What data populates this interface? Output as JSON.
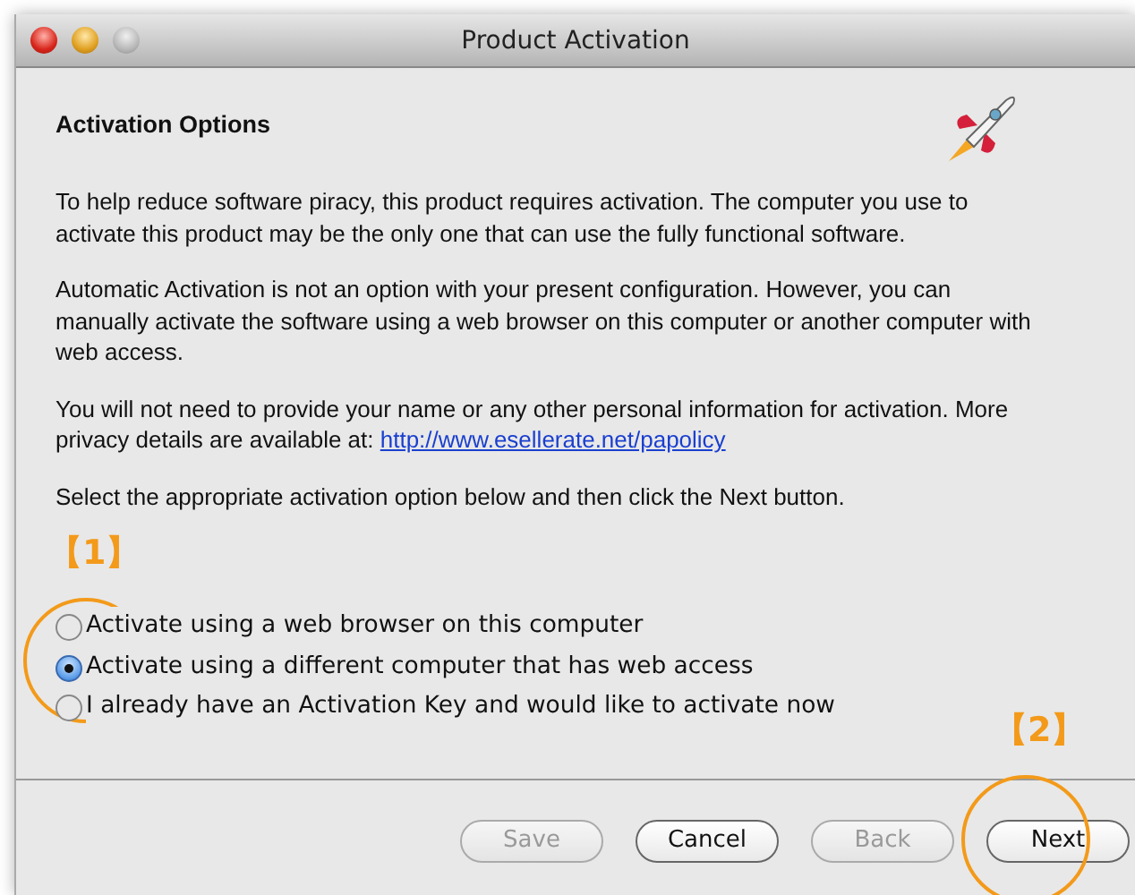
{
  "window": {
    "title": "Product Activation"
  },
  "heading": "Activation Options",
  "paragraphs": [
    {
      "text": "To help reduce software piracy, this product requires activation. The computer you use to activate this product may be the only one that can use the fully functional software."
    },
    {
      "text": "Automatic Activation is not an option with your present configuration. However, you can manually activate the software using a web browser on this computer or another computer with web access."
    },
    {
      "text": "You will not need to provide your name or any other personal information for activation. More privacy details are available at: ",
      "link": "http://www.esellerate.net/papolicy"
    },
    {
      "text": "Select the appropriate activation option below and then click the Next button."
    }
  ],
  "annotations": [
    "【1】",
    "【2】"
  ],
  "options": [
    {
      "label": "Activate using a web browser on this computer",
      "selected": false
    },
    {
      "label": "Activate using a different computer that has web access",
      "selected": true
    },
    {
      "label": "I already have an Activation Key and would like to activate now",
      "selected": false
    }
  ],
  "buttons": [
    {
      "label": "Save",
      "disabled": true
    },
    {
      "label": "Cancel",
      "disabled": false
    },
    {
      "label": "Back",
      "disabled": true
    },
    {
      "label": "Next",
      "disabled": false
    }
  ]
}
